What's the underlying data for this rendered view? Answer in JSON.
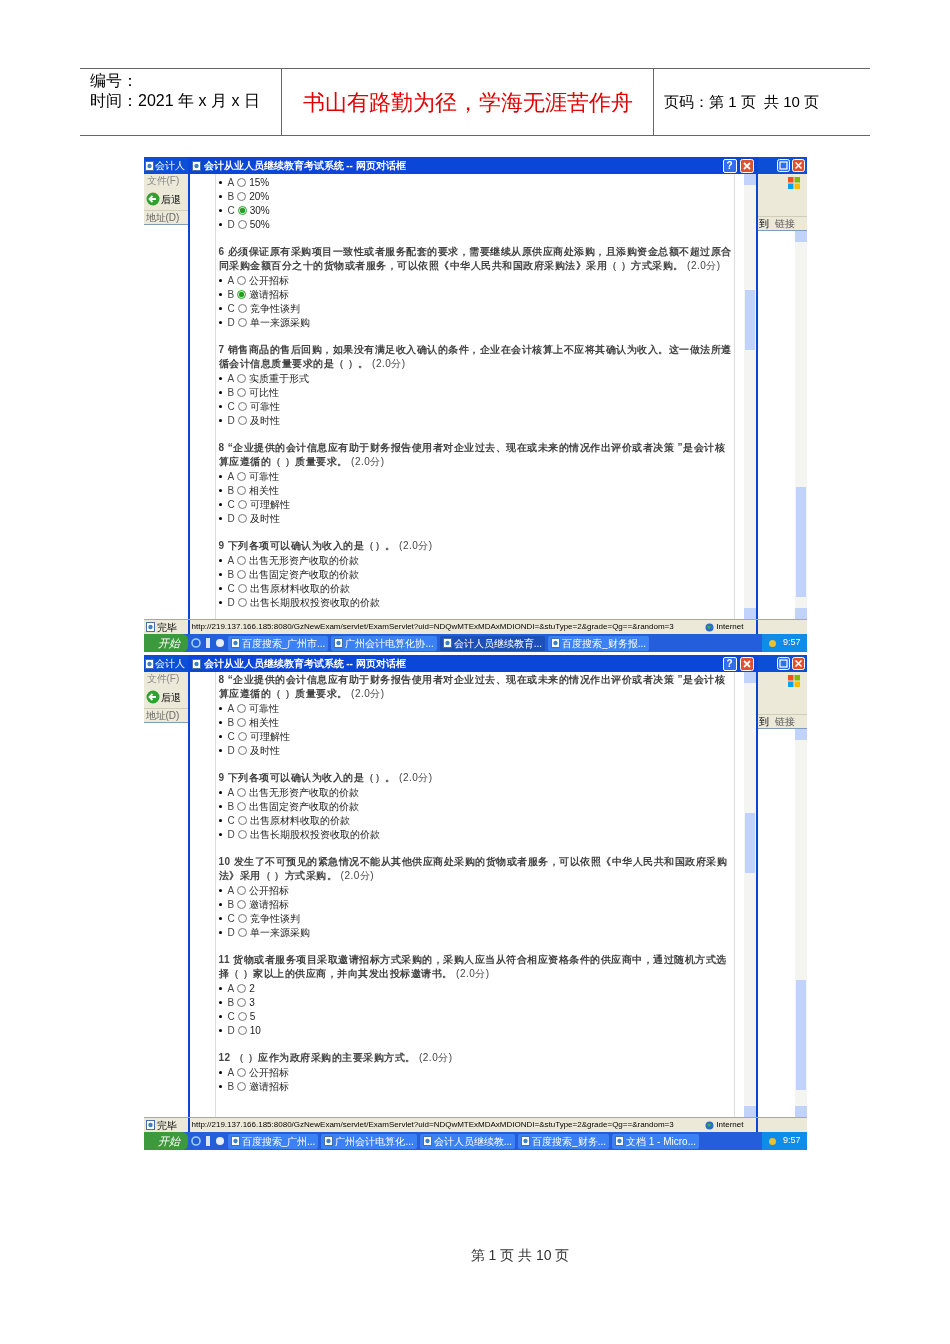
{
  "header": {
    "number_label": "编号：",
    "time": "时间：2021 年 x 月 x 日",
    "motto": "书山有路勤为径，学海无涯苦作舟",
    "page": "页码：第 1 页  共 10 页"
  },
  "screenshots": [
    {
      "browser": {
        "title": "会计人",
        "menu": "文件(F)",
        "back": "后退",
        "address_label": "地址(D)",
        "go": "到",
        "links": "链接"
      },
      "dialog_title": "会计从业人员继续教育考试系统 -- 网页对话框",
      "help_button": "?",
      "questions": [
        {
          "options": [
            {
              "letter": "A",
              "text": "15%",
              "selected": false
            },
            {
              "letter": "B",
              "text": "20%",
              "selected": false
            },
            {
              "letter": "C",
              "text": "30%",
              "selected": true
            },
            {
              "letter": "D",
              "text": "50%",
              "selected": false
            }
          ]
        },
        {
          "text": "**6 必须保证原有采购项目一致性或者服务配套的要求，需要继续从原供应商处添购，且添购资金总额不超过原合同采购金额百分之十的货物或者服务，可以依照《中华人民共和国政府采购法》采用（ ）方式采购。** (2.0分)",
          "options": [
            {
              "letter": "A",
              "text": "公开招标",
              "selected": false
            },
            {
              "letter": "B",
              "text": "邀请招标",
              "selected": true
            },
            {
              "letter": "C",
              "text": "竞争性谈判",
              "selected": false
            },
            {
              "letter": "D",
              "text": "单一来源采购",
              "selected": false
            }
          ]
        },
        {
          "text": "**7 销售商品的售后回购，如果没有满足收入确认的条件，企业在会计核算上不应将其确认为收入。这一做法所遵循会计信息质量要求的是（ ）。** (2.0分)",
          "options": [
            {
              "letter": "A",
              "text": "实质重于形式",
              "selected": false
            },
            {
              "letter": "B",
              "text": "可比性",
              "selected": false
            },
            {
              "letter": "C",
              "text": "可靠性",
              "selected": false
            },
            {
              "letter": "D",
              "text": "及时性",
              "selected": false
            }
          ]
        },
        {
          "text": "**8 “企业提供的会计信息应有助于财务报告使用者对企业过去、现在或未来的情况作出评价或者决策 ”是会计核算应遵循的（ ）质量要求。** (2.0分)",
          "options": [
            {
              "letter": "A",
              "text": "可靠性",
              "selected": false
            },
            {
              "letter": "B",
              "text": "相关性",
              "selected": false
            },
            {
              "letter": "C",
              "text": "可理解性",
              "selected": false
            },
            {
              "letter": "D",
              "text": "及时性",
              "selected": false
            }
          ]
        },
        {
          "text": "**9 下列各项可以确认为收入的是（）。** (2.0分)",
          "options": [
            {
              "letter": "A",
              "text": "出售无形资产收取的价款",
              "selected": false
            },
            {
              "letter": "B",
              "text": "出售固定资产收取的价款",
              "selected": false
            },
            {
              "letter": "C",
              "text": "出售原材料收取的价款",
              "selected": false
            },
            {
              "letter": "D",
              "text": "出售长期股权投资收取的价款",
              "selected": false
            }
          ]
        }
      ],
      "status": {
        "text": "完毕",
        "url": "http://219.137.166.185:8080/GzNewExam/servlet/ExamServlet?uid=NDQwMTExMDAxMDIONDI=&stuType=2&grade=Qg==&random=3",
        "zone": "Internet"
      },
      "taskbar": {
        "start": "开始",
        "tasks": [
          {
            "label": "百度搜索_广州市...",
            "selected": false
          },
          {
            "label": "广州会计电算化协...",
            "selected": false
          },
          {
            "label": "会计人员继续教育...",
            "selected": true
          },
          {
            "label": "百度搜索_财务报...",
            "selected": false
          }
        ],
        "time": "9:57"
      }
    },
    {
      "browser": {
        "title": "会计人",
        "menu": "文件(F)",
        "back": "后退",
        "address_label": "地址(D)",
        "go": "到",
        "links": "链接"
      },
      "dialog_title": "会计从业人员继续教育考试系统 -- 网页对话框",
      "help_button": "?",
      "questions": [
        {
          "text": "**8 “企业提供的会计信息应有助于财务报告使用者对企业过去、现在或未来的情况作出评价或者决策 ”是会计核算应遵循的（ ）质量要求。** (2.0分)",
          "options": [
            {
              "letter": "A",
              "text": "可靠性",
              "selected": false
            },
            {
              "letter": "B",
              "text": "相关性",
              "selected": false
            },
            {
              "letter": "C",
              "text": "可理解性",
              "selected": false
            },
            {
              "letter": "D",
              "text": "及时性",
              "selected": false
            }
          ]
        },
        {
          "text": "**9 下列各项可以确认为收入的是（）。** (2.0分)",
          "options": [
            {
              "letter": "A",
              "text": "出售无形资产收取的价款",
              "selected": false
            },
            {
              "letter": "B",
              "text": "出售固定资产收取的价款",
              "selected": false
            },
            {
              "letter": "C",
              "text": "出售原材料收取的价款",
              "selected": false
            },
            {
              "letter": "D",
              "text": "出售长期股权投资收取的价款",
              "selected": false
            }
          ]
        },
        {
          "text": "**10 发生了不可预见的紧急情况不能从其他供应商处采购的货物或者服务，可以依照《中华人民共和国政府采购法》采用（ ）方式采购。** (2.0分)",
          "options": [
            {
              "letter": "A",
              "text": "公开招标",
              "selected": false
            },
            {
              "letter": "B",
              "text": "邀请招标",
              "selected": false
            },
            {
              "letter": "C",
              "text": "竞争性谈判",
              "selected": false
            },
            {
              "letter": "D",
              "text": "单一来源采购",
              "selected": false
            }
          ]
        },
        {
          "text": "**11 货物或者服务项目采取邀请招标方式采购的，采购人应当从符合相应资格条件的供应商中，通过随机方式选择（ ）家以上的供应商，并向其发出投标邀请书。** (2.0分)",
          "options": [
            {
              "letter": "A",
              "text": "2",
              "selected": false
            },
            {
              "letter": "B",
              "text": "3",
              "selected": false
            },
            {
              "letter": "C",
              "text": "5",
              "selected": false
            },
            {
              "letter": "D",
              "text": "10",
              "selected": false
            }
          ]
        },
        {
          "text": "**12 （ ）应作为政府采购的主要采购方式。** (2.0分)",
          "options": [
            {
              "letter": "A",
              "text": "公开招标",
              "selected": false
            },
            {
              "letter": "B",
              "text": "邀请招标",
              "selected": false
            }
          ]
        }
      ],
      "status": {
        "text": "完毕",
        "url": "http://219.137.166.185:8080/GzNewExam/servlet/ExamServlet?uid=NDQwMTExMDAxMDIONDI=&stuType=2&grade=Qg==&random=3",
        "zone": "Internet"
      },
      "taskbar": {
        "start": "开始",
        "tasks": [
          {
            "label": "百度搜索_广州...",
            "selected": false
          },
          {
            "label": "广州会计电算化...",
            "selected": false
          },
          {
            "label": "会计人员继续教...",
            "selected": false
          },
          {
            "label": "百度搜索_财务...",
            "selected": false
          },
          {
            "label": "文档 1 - Micro...",
            "selected": false
          }
        ],
        "time": "9:57"
      }
    }
  ],
  "footer": "第 1 页 共 10 页"
}
